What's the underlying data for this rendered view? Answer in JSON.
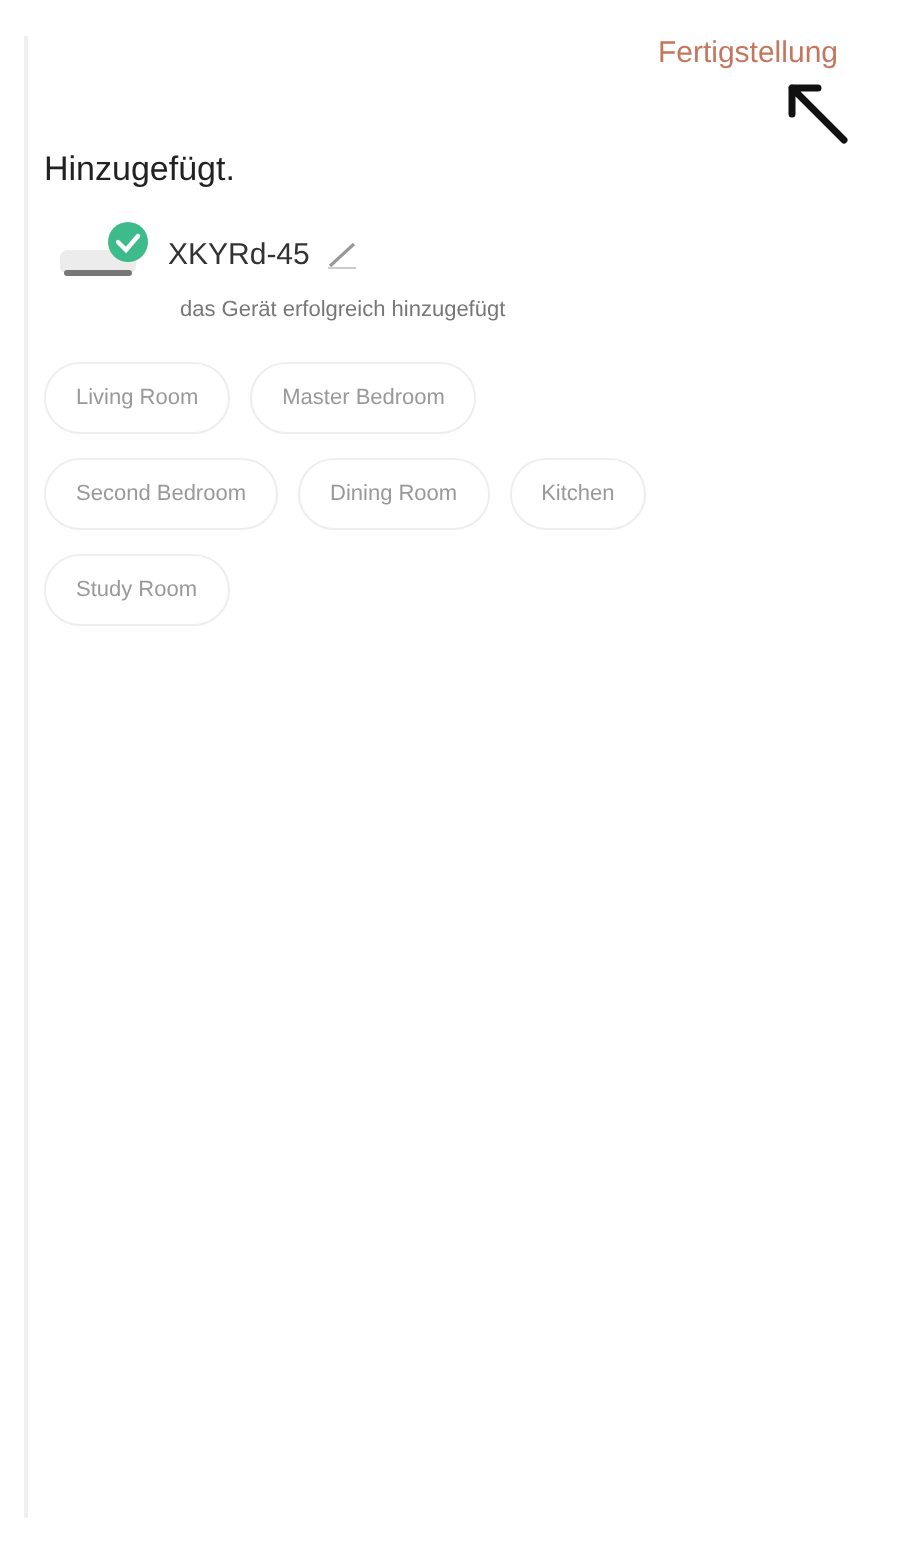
{
  "header": {
    "done_link": "Fertigstellung"
  },
  "title": "Hinzugefügt.",
  "device": {
    "name": "XKYRd-45",
    "status": "das Gerät erfolgreich hinzugefügt"
  },
  "rooms": [
    "Living Room",
    "Master Bedroom",
    "Second Bedroom",
    "Dining Room",
    "Kitchen",
    "Study Room"
  ]
}
